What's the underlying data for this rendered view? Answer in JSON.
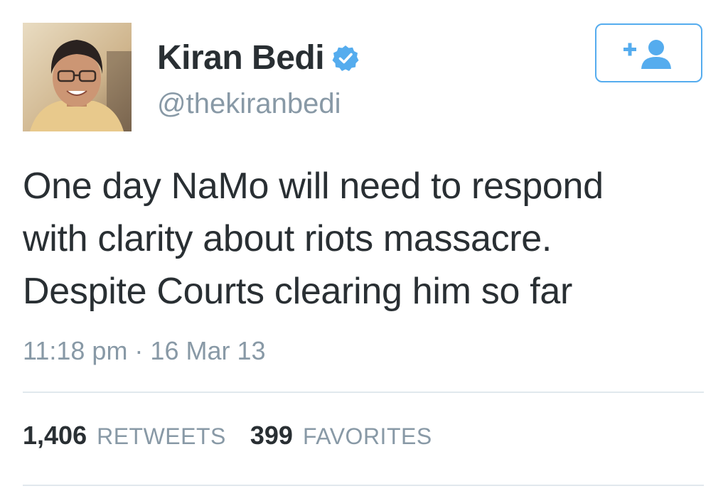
{
  "author": {
    "display_name": "Kiran Bedi",
    "handle": "@thekiranbedi",
    "verified_icon": "verified-badge-icon",
    "avatar_icon": "profile-avatar"
  },
  "follow_button": {
    "icon": "follow-person-add-icon"
  },
  "tweet": {
    "text_lines": [
      "One day NaMo will need to respond",
      "with clarity about riots massacre.",
      "Despite Courts clearing him so far"
    ],
    "timestamp": "11:18 pm · 16 Mar 13"
  },
  "stats": {
    "retweets_count": "1,406",
    "retweets_label": "RETWEETS",
    "favorites_count": "399",
    "favorites_label": "FAVORITES"
  },
  "colors": {
    "accent": "#55acee",
    "text_primary": "#292f33",
    "text_secondary": "#8899a6",
    "divider": "#e1e8ed"
  }
}
